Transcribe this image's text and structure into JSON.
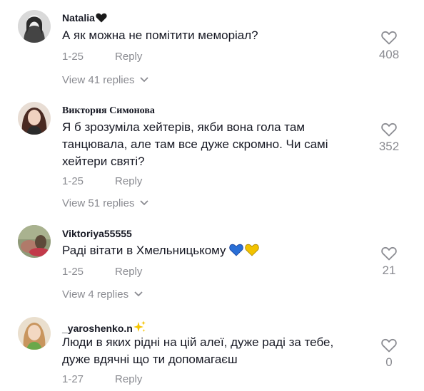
{
  "comments": [
    {
      "username": "Natalia",
      "text": "А як можна не помітити меморіал?",
      "date": "1-25",
      "reply_label": "Reply",
      "likes": "408",
      "view_replies": "View 41 replies",
      "avatar_color": "#6b6b6b"
    },
    {
      "username": "Виктория Симонова",
      "text": "Я б зрозуміла хейтерів, якби вона гола там танцювала, але там все дуже скромно. Чи самі хейтери святі?",
      "date": "1-25",
      "reply_label": "Reply",
      "likes": "352",
      "view_replies": "View 51 replies",
      "avatar_color": "#7a4a3a"
    },
    {
      "username": "Viktoriya55555",
      "text": "Раді вітати в Хмельницькому",
      "date": "1-25",
      "reply_label": "Reply",
      "likes": "21",
      "view_replies": "View 4 replies",
      "avatar_color": "#6e7a5a"
    },
    {
      "username": "_yaroshenko.n",
      "text": "Люди в яких рідні на цій алеї, дуже раді за тебе, дуже вдячні що ти допомагаєш",
      "date": "1-27",
      "reply_label": "Reply",
      "likes": "0",
      "avatar_color": "#d9b48f"
    }
  ],
  "icons": {
    "like": "heart-outline-icon",
    "expand": "chevron-down-icon",
    "badge_1": "black-heart-icon",
    "badge_4": "sparkles-icon",
    "flags": [
      "blue-heart-icon",
      "yellow-heart-icon"
    ]
  },
  "colors": {
    "secondary_text": "#8a8b91",
    "primary_text": "#161823",
    "blue_heart": "#2a6fd6",
    "yellow_heart": "#f2c200",
    "sparkle": "#f5c400"
  }
}
